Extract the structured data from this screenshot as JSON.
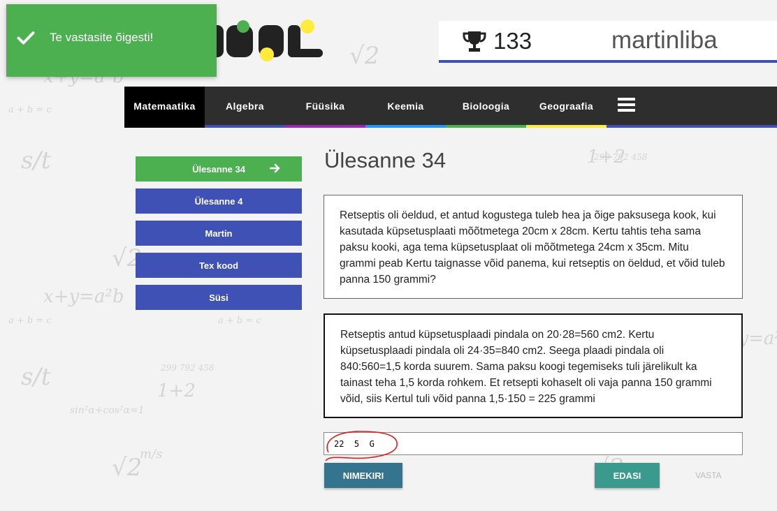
{
  "toast": {
    "message": "Te vastasite õigesti!"
  },
  "header": {
    "score": "133",
    "username": "martinliba"
  },
  "nav": {
    "items": [
      {
        "label": "Matemaatika",
        "color": "#000000"
      },
      {
        "label": "Algebra",
        "color": "#3f51b5"
      },
      {
        "label": "Füüsika",
        "color": "#9c27b0"
      },
      {
        "label": "Keemia",
        "color": "#2196f3"
      },
      {
        "label": "Bioloogia",
        "color": "#4caf50"
      },
      {
        "label": "Geograafia",
        "color": "#ffeb3b"
      }
    ]
  },
  "sidebar": {
    "items": [
      {
        "label": "Ülesanne 34"
      },
      {
        "label": "Ülesanne 4"
      },
      {
        "label": "Martin"
      },
      {
        "label": "Tex kood"
      },
      {
        "label": "Süsi"
      }
    ]
  },
  "task": {
    "title": "Ülesanne 34",
    "question": "Retseptis oli öeldud, et antud kogustega tuleb hea ja õige paksusega kook, kui kasutada küpsetusplaati mõõtmetega 20cm x 28cm. Kertu tahtis teha sama paksu kooki, aga tema küpsetusplaat oli mõõtmetega 24cm x 35cm. Mitu grammi peab Kertu taignasse võid panema, kui retseptis on öeldud, et võid tuleb panna 150 grammi?",
    "solution": "Retseptis antud küpsetusplaadi pindala on 20·28=560 cm2. Kertu küpsetusplaadi pindala oli 24·35=840 cm2. Seega plaadi pindala oli 840:560=1,5 korda suurem. Sama paksu koogi tegemiseks tuli järelikult ka tainast teha 1,5 korda rohkem. Et retsepti kohaselt oli vaja panna 150 grammi võid, siis Kertul tuli võid panna 1,5·150 = 225 grammi",
    "answer_value": "22  5  G"
  },
  "buttons": {
    "list": "NIMEKIRI",
    "next": "EDASI",
    "submit": "VASTA"
  },
  "colors": {
    "green": "#4caf50",
    "blue": "#3f51b5",
    "teal": "#3a9a8e",
    "steel": "#35748f"
  }
}
